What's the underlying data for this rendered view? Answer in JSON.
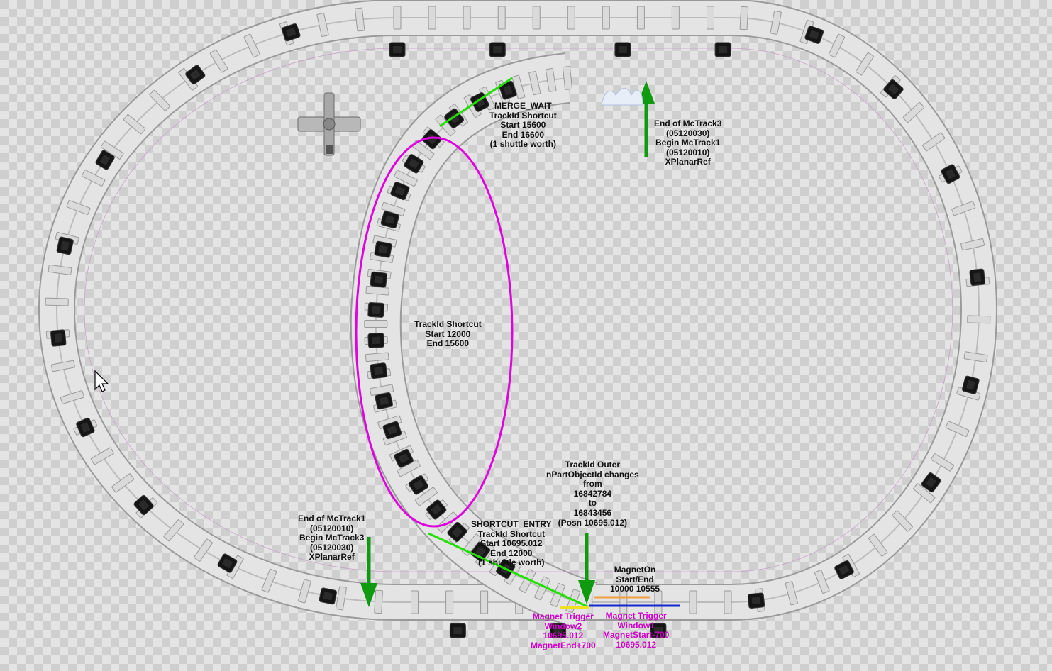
{
  "labels": {
    "merge_wait": [
      "MERGE_WAIT",
      "TrackId Shortcut",
      "Start 15600",
      "End 16600",
      "(1 shuttle worth)"
    ],
    "end_mctrack3": [
      "End of McTrack3",
      "(05120030)",
      "Begin McTrack1",
      "(05120010)",
      "XPlanarRef"
    ],
    "shortcut_mid": [
      "TrackId Shortcut",
      "Start 12000",
      "End 15600"
    ],
    "outer_change": [
      "TrackId Outer",
      "nPartObjectId changes",
      "from",
      "16842784",
      "to",
      "16843456",
      "(Posn 10695.012)"
    ],
    "end_mctrack1": [
      "End of McTrack1",
      "(05120010)",
      "Begin McTrack3",
      "(05120030)",
      "XPlanarRef"
    ],
    "shortcut_entry": [
      "SHORTCUT_ENTRY",
      "TrackId Shortcut",
      "Start 10695.012",
      "End 12000",
      "(1 shuttle worth)"
    ],
    "magnet_on": [
      "MagnetOn",
      "Start/End",
      "10000 10555"
    ],
    "trigger_window2": [
      "Magnet Trigger",
      "Window2",
      "10695.012",
      "MagnetEnd+700"
    ],
    "trigger_window1": [
      "Magnet Trigger",
      "Window1",
      "MagnetStart-700",
      "10695.012"
    ]
  },
  "colors": {
    "annotation_text": "#111111",
    "magnet_text": "#d000c8",
    "shortcut_ellipse": "#e000e0",
    "range_line": "#22e000",
    "arrow": "#109a10",
    "window1_bar": "#1428d0",
    "window2_bar": "#f0e020",
    "magnet_on_bar": "#f0a040",
    "track": "#e4e4e4",
    "shuttle": "#111111"
  },
  "icons": {
    "pointer": "mouse-cursor-icon",
    "robot": "robot-arm-icon"
  }
}
